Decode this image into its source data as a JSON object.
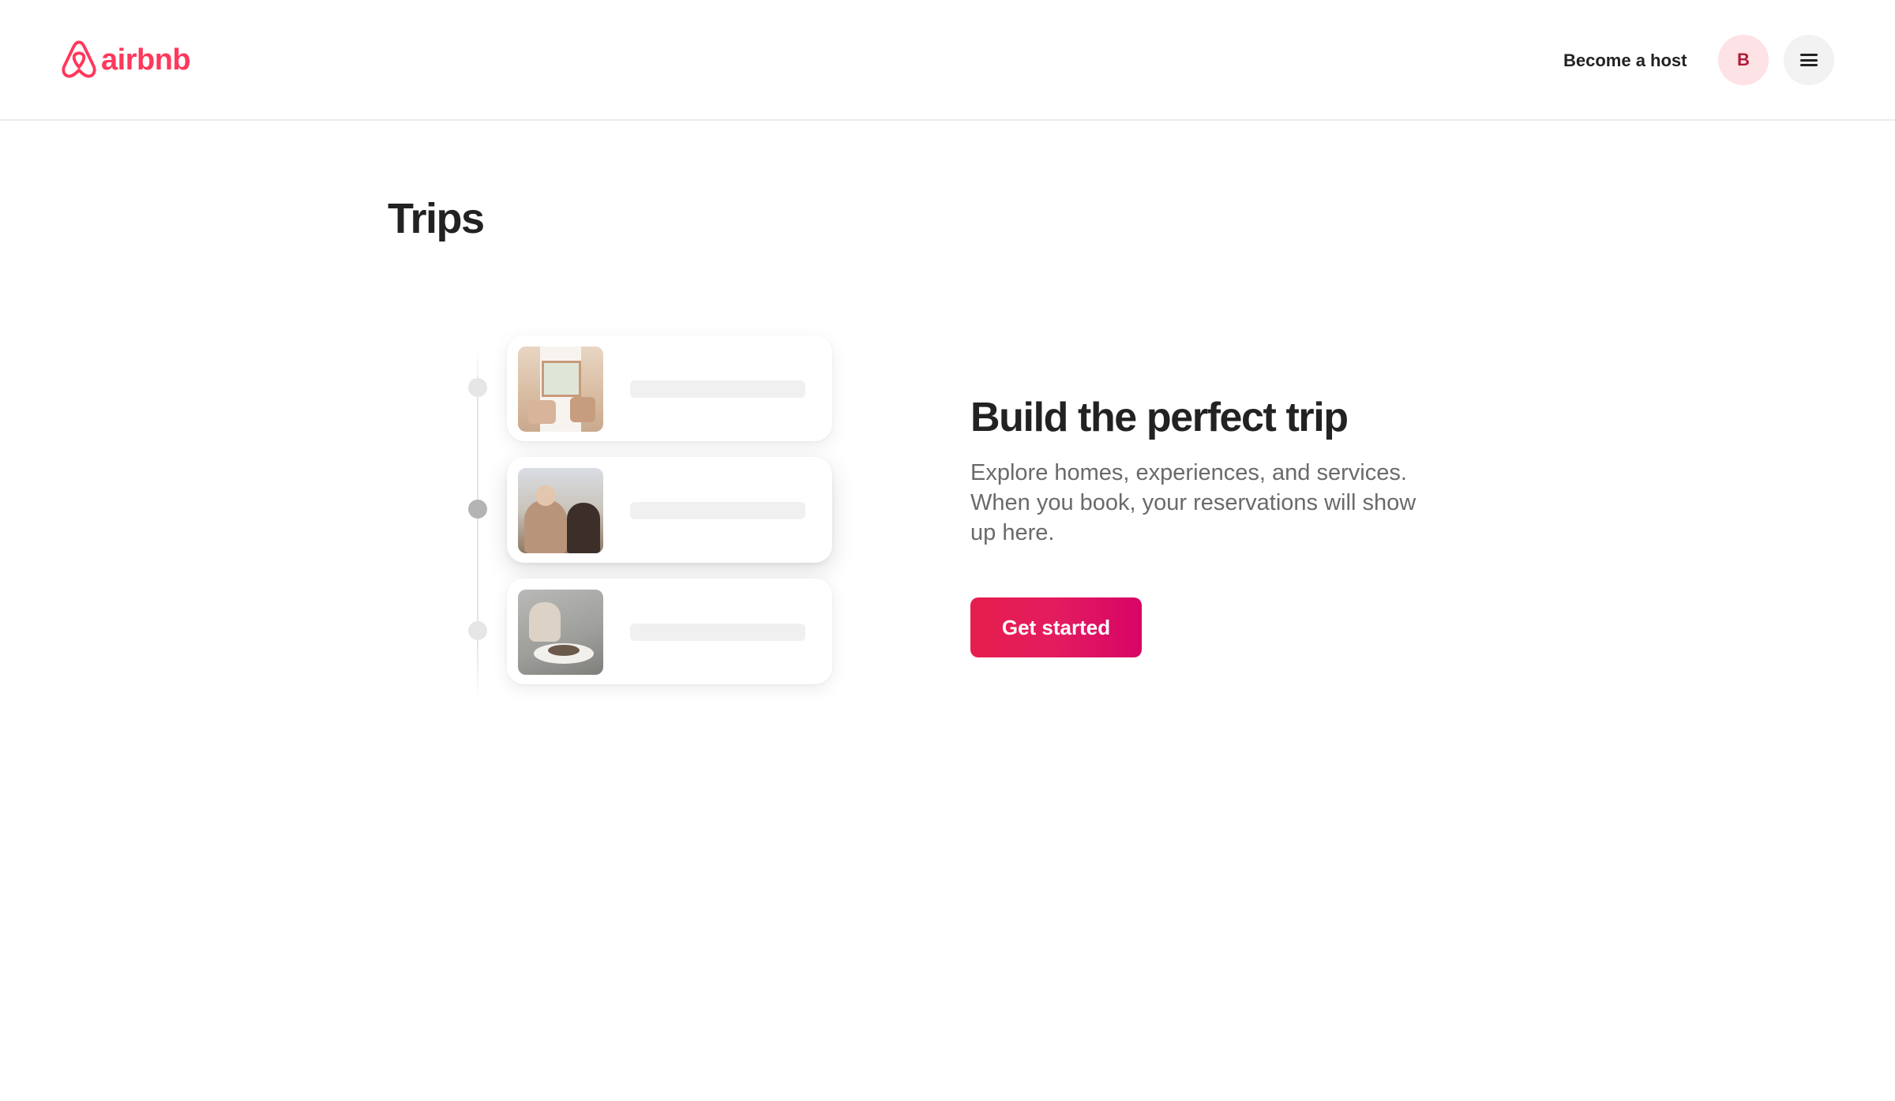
{
  "header": {
    "logo_text": "airbnb",
    "become_host_label": "Become a host",
    "avatar_initial": "B",
    "brand_color": "#ff385c"
  },
  "page": {
    "title": "Trips"
  },
  "illustration": {
    "cards": [
      {
        "thumb_icon": "room-photo"
      },
      {
        "thumb_icon": "people-photo"
      },
      {
        "thumb_icon": "food-photo"
      }
    ]
  },
  "empty_state": {
    "title": "Build the perfect trip",
    "description": "Explore homes, experiences, and services. When you book, your reservations will show up here.",
    "button_label": "Get started",
    "button_color": "#e31c5f"
  }
}
